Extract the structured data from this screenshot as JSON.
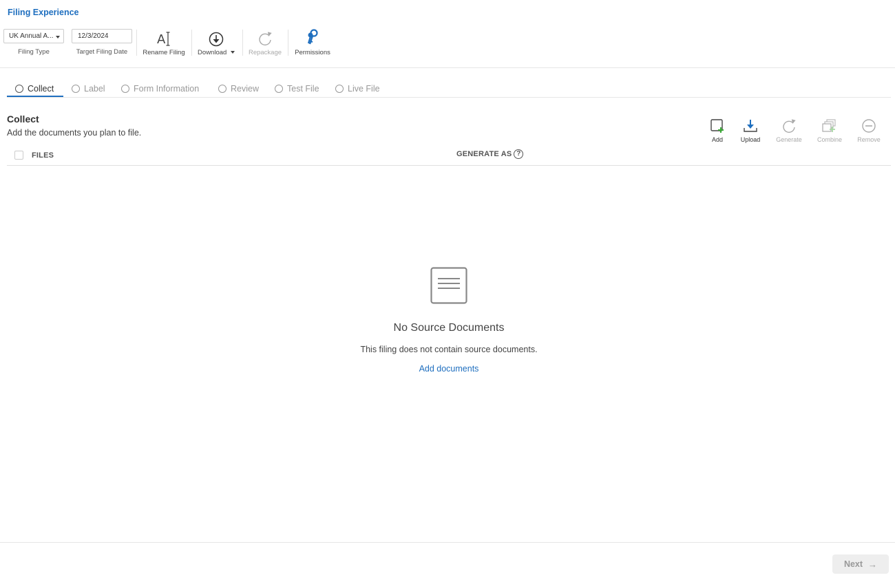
{
  "app": {
    "title": "Filing Experience"
  },
  "toolbar": {
    "filing_type": {
      "value": "UK Annual A...",
      "caption": "Filing Type"
    },
    "target_date": {
      "value": "12/3/2024",
      "caption": "Target Filing Date"
    },
    "rename": {
      "label": "Rename Filing",
      "icon": "rename-text-icon"
    },
    "download": {
      "label": "Download",
      "icon": "download-circle-icon"
    },
    "repackage": {
      "label": "Repackage",
      "icon": "refresh-icon",
      "disabled": true
    },
    "permissions": {
      "label": "Permissions",
      "icon": "keys-icon"
    }
  },
  "steps": [
    {
      "label": "Collect",
      "active": true
    },
    {
      "label": "Label"
    },
    {
      "label": "Form Information"
    },
    {
      "label": "Review"
    },
    {
      "label": "Test File"
    },
    {
      "label": "Live File"
    }
  ],
  "section": {
    "title": "Collect",
    "description": "Add the documents you plan to file."
  },
  "actions": {
    "add": {
      "label": "Add"
    },
    "upload": {
      "label": "Upload"
    },
    "generate": {
      "label": "Generate",
      "disabled": true
    },
    "combine": {
      "label": "Combine",
      "disabled": true
    },
    "remove": {
      "label": "Remove",
      "disabled": true
    }
  },
  "table": {
    "col_files": "FILES",
    "col_generate": "GENERATE AS",
    "help_glyph": "?"
  },
  "empty_state": {
    "title": "No Source Documents",
    "description": "This filing does not contain source documents.",
    "link": "Add documents"
  },
  "footer": {
    "next_label": "Next",
    "next_arrow": "→"
  },
  "colors": {
    "accent": "#1f6fbf",
    "add_green": "#3aa935",
    "disabled": "#aaaaaa"
  }
}
